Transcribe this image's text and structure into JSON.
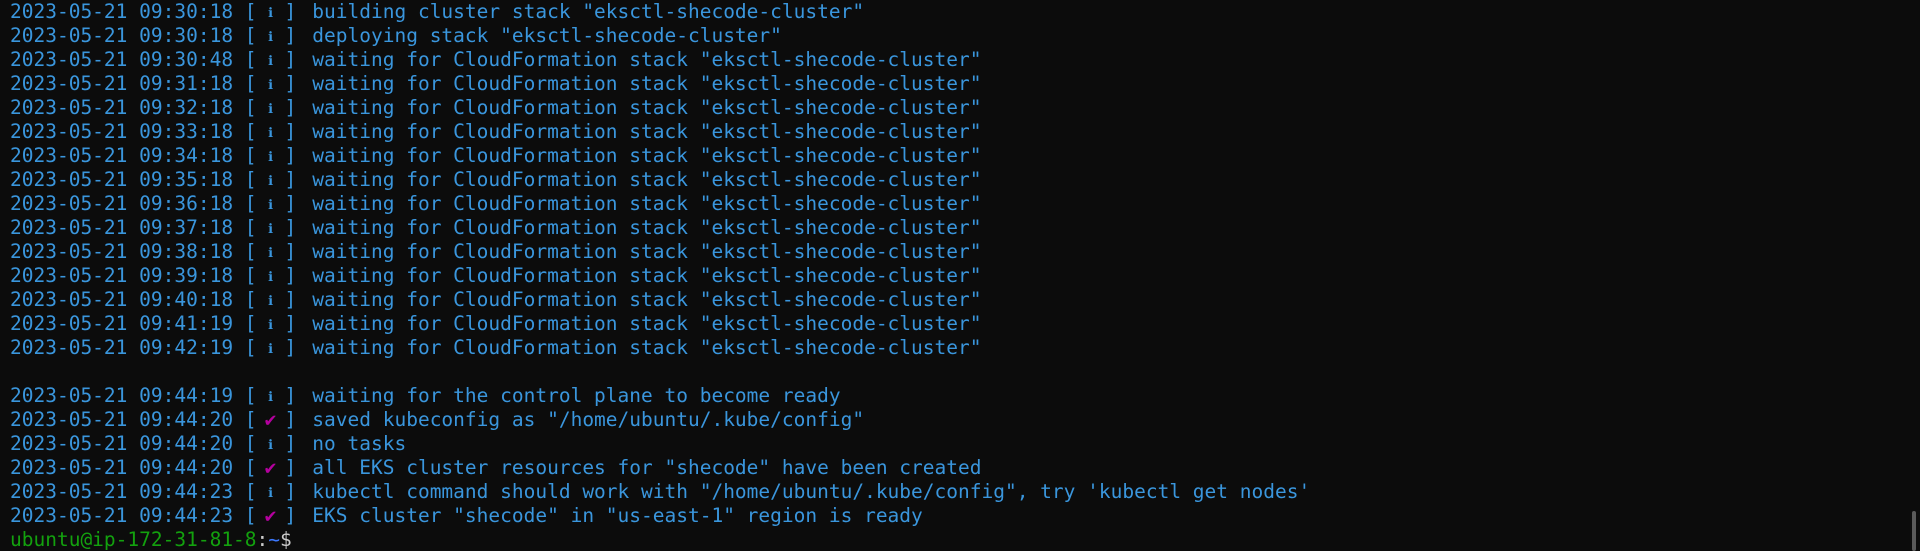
{
  "terminal": {
    "lines": [
      {
        "ts": "2023-05-21 09:30:18",
        "icon": "info",
        "glyph": "ℹ",
        "msg": "building cluster stack \"eksctl-shecode-cluster\""
      },
      {
        "ts": "2023-05-21 09:30:18",
        "icon": "info",
        "glyph": "ℹ",
        "msg": "deploying stack \"eksctl-shecode-cluster\""
      },
      {
        "ts": "2023-05-21 09:30:48",
        "icon": "info",
        "glyph": "ℹ",
        "msg": "waiting for CloudFormation stack \"eksctl-shecode-cluster\""
      },
      {
        "ts": "2023-05-21 09:31:18",
        "icon": "info",
        "glyph": "ℹ",
        "msg": "waiting for CloudFormation stack \"eksctl-shecode-cluster\""
      },
      {
        "ts": "2023-05-21 09:32:18",
        "icon": "info",
        "glyph": "ℹ",
        "msg": "waiting for CloudFormation stack \"eksctl-shecode-cluster\""
      },
      {
        "ts": "2023-05-21 09:33:18",
        "icon": "info",
        "glyph": "ℹ",
        "msg": "waiting for CloudFormation stack \"eksctl-shecode-cluster\""
      },
      {
        "ts": "2023-05-21 09:34:18",
        "icon": "info",
        "glyph": "ℹ",
        "msg": "waiting for CloudFormation stack \"eksctl-shecode-cluster\""
      },
      {
        "ts": "2023-05-21 09:35:18",
        "icon": "info",
        "glyph": "ℹ",
        "msg": "waiting for CloudFormation stack \"eksctl-shecode-cluster\""
      },
      {
        "ts": "2023-05-21 09:36:18",
        "icon": "info",
        "glyph": "ℹ",
        "msg": "waiting for CloudFormation stack \"eksctl-shecode-cluster\""
      },
      {
        "ts": "2023-05-21 09:37:18",
        "icon": "info",
        "glyph": "ℹ",
        "msg": "waiting for CloudFormation stack \"eksctl-shecode-cluster\""
      },
      {
        "ts": "2023-05-21 09:38:18",
        "icon": "info",
        "glyph": "ℹ",
        "msg": "waiting for CloudFormation stack \"eksctl-shecode-cluster\""
      },
      {
        "ts": "2023-05-21 09:39:18",
        "icon": "info",
        "glyph": "ℹ",
        "msg": "waiting for CloudFormation stack \"eksctl-shecode-cluster\""
      },
      {
        "ts": "2023-05-21 09:40:18",
        "icon": "info",
        "glyph": "ℹ",
        "msg": "waiting for CloudFormation stack \"eksctl-shecode-cluster\""
      },
      {
        "ts": "2023-05-21 09:41:19",
        "icon": "info",
        "glyph": "ℹ",
        "msg": "waiting for CloudFormation stack \"eksctl-shecode-cluster\""
      },
      {
        "ts": "2023-05-21 09:42:19",
        "icon": "info",
        "glyph": "ℹ",
        "msg": "waiting for CloudFormation stack \"eksctl-shecode-cluster\""
      },
      {
        "ts": "",
        "icon": "",
        "glyph": "",
        "msg": ""
      },
      {
        "ts": "2023-05-21 09:44:19",
        "icon": "info",
        "glyph": "ℹ",
        "msg": "waiting for the control plane to become ready"
      },
      {
        "ts": "2023-05-21 09:44:20",
        "icon": "check",
        "glyph": "✔",
        "msg": "saved kubeconfig as \"/home/ubuntu/.kube/config\""
      },
      {
        "ts": "2023-05-21 09:44:20",
        "icon": "info",
        "glyph": "ℹ",
        "msg": "no tasks"
      },
      {
        "ts": "2023-05-21 09:44:20",
        "icon": "check",
        "glyph": "✔",
        "msg": "all EKS cluster resources for \"shecode\" have been created"
      },
      {
        "ts": "2023-05-21 09:44:23",
        "icon": "info",
        "glyph": "ℹ",
        "msg": "kubectl command should work with \"/home/ubuntu/.kube/config\", try 'kubectl get nodes'"
      },
      {
        "ts": "2023-05-21 09:44:23",
        "icon": "check",
        "glyph": "✔",
        "msg": "EKS cluster \"shecode\" in \"us-east-1\" region is ready"
      }
    ],
    "prompt": {
      "user_host": "ubuntu@ip-172-31-81-8",
      "separator": ":",
      "path": "~",
      "symbol": "$"
    }
  },
  "colors": {
    "background": "#0c0c0c",
    "text_blue": "#3a96dd",
    "check_magenta": "#b4009e",
    "prompt_green": "#13a10e",
    "prompt_path_blue": "#3b78ff"
  }
}
